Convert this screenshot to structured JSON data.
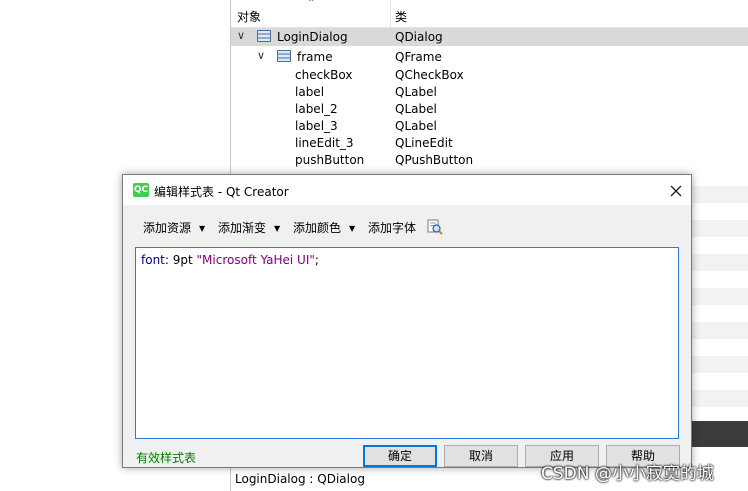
{
  "inspector": {
    "col_object": "对象",
    "col_class": "类",
    "rows": [
      {
        "name": "LoginDialog",
        "cls": "QDialog"
      },
      {
        "name": "frame",
        "cls": "QFrame"
      },
      {
        "name": "checkBox",
        "cls": "QCheckBox"
      },
      {
        "name": "label",
        "cls": "QLabel"
      },
      {
        "name": "label_2",
        "cls": "QLabel"
      },
      {
        "name": "label_3",
        "cls": "QLabel"
      },
      {
        "name": "lineEdit_3",
        "cls": "QLineEdit"
      },
      {
        "name": "pushButton",
        "cls": "QPushButton"
      }
    ],
    "footer": "LoginDialog : QDialog"
  },
  "dialog": {
    "icon_text": "QC",
    "title": "编辑样式表 - Qt Creator",
    "toolbar": {
      "add_resource": "添加资源",
      "add_gradient": "添加渐变",
      "add_color": "添加颜色",
      "add_font": "添加字体"
    },
    "editor": {
      "prop": "font",
      "colon": ": ",
      "size": "9pt ",
      "family": "\"Microsoft YaHei UI\"",
      "semi": ";"
    },
    "status": "有效样式表",
    "buttons": {
      "ok": "确定",
      "cancel": "取消",
      "apply": "应用",
      "help": "帮助"
    }
  },
  "watermark": "CSDN @小小寂寞的城",
  "colors": {
    "accent": "#0078d7",
    "valid": "#008000",
    "qt_green": "#41cd52"
  }
}
